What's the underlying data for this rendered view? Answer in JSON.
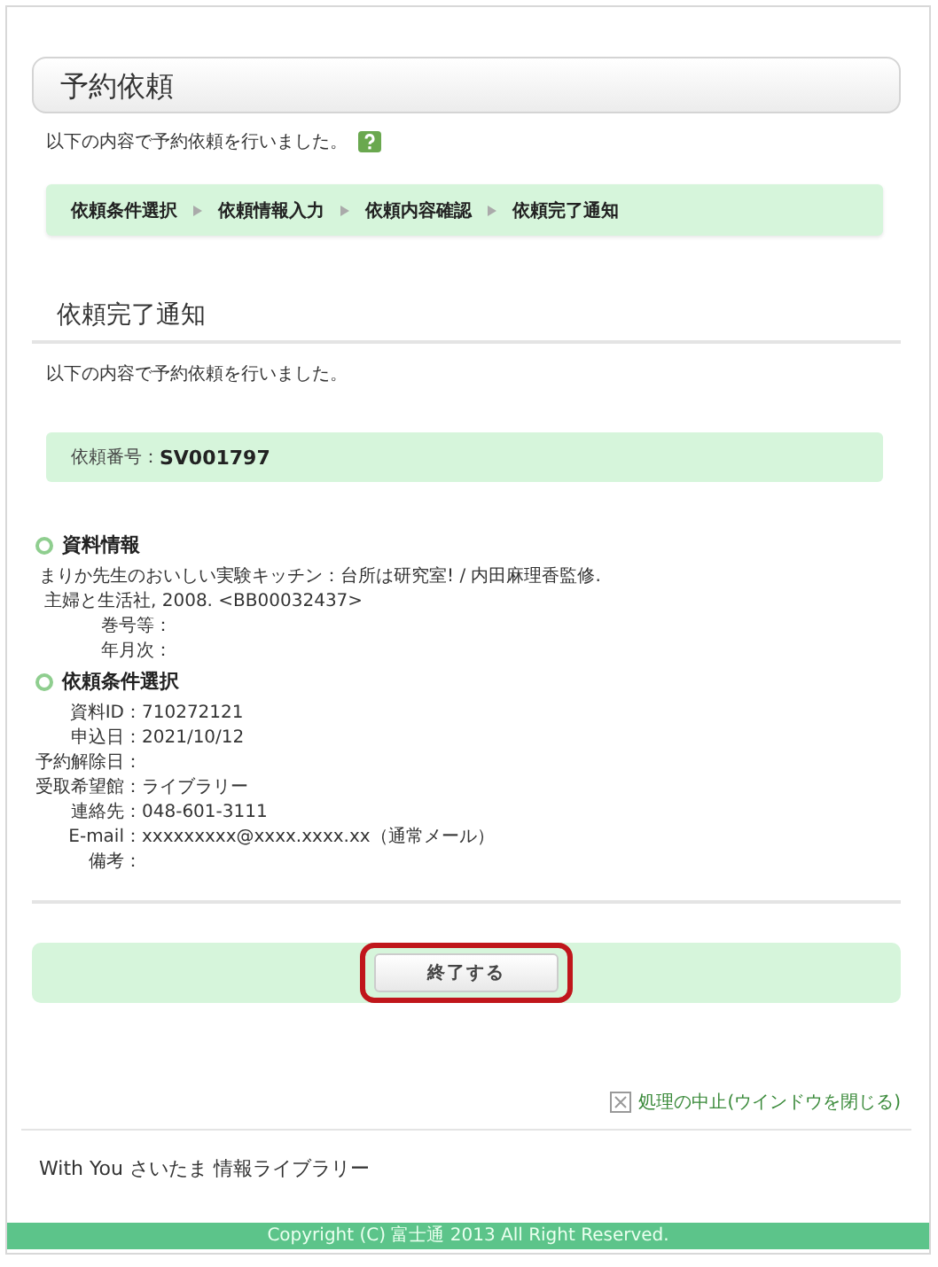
{
  "page_title": "予約依頼",
  "intro": "以下の内容で予約依頼を行いました。",
  "steps": [
    "依頼条件選択",
    "依頼情報入力",
    "依頼内容確認",
    "依頼完了通知"
  ],
  "section_title": "依頼完了通知",
  "section_text": "以下の内容で予約依頼を行いました。",
  "request_number": {
    "label": "依頼番号：",
    "value": "SV001797"
  },
  "groups": [
    {
      "title": "資料情報",
      "lines": [
        "まりか先生のおいしい実験キッチン：台所は研究室! / 内田麻理香監修.",
        "主婦と生活社, 2008.  <BB00032437>"
      ],
      "fields": [
        {
          "label": "巻号等："
        },
        {
          "label": "年月次："
        }
      ]
    },
    {
      "title": "依頼条件選択",
      "fields": [
        {
          "label": "資料ID：",
          "value": "710272121"
        },
        {
          "label": "申込日：",
          "value": "2021/10/12"
        },
        {
          "label": "予約解除日："
        },
        {
          "label": "受取希望館：",
          "value": "ライブラリー"
        },
        {
          "label": "連絡先：",
          "value": "048-601-3111"
        },
        {
          "label": "E-mail：",
          "value": "xxxxxxxxx@xxxx.xxxx.xx（通常メール）"
        },
        {
          "label": "備考："
        }
      ]
    }
  ],
  "finish_button": "終了する",
  "cancel_link": "処理の中止(ウインドウを閉じる)",
  "footer_name": "With You さいたま 情報ライブラリー",
  "copyright": "Copyright (C) 富士通 2013 All Right Reserved."
}
